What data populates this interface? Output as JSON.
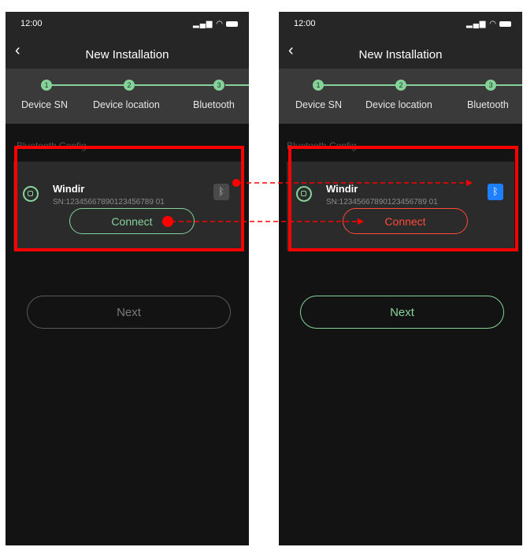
{
  "screens": [
    {
      "id": "left",
      "status_time": "12:00",
      "nav_title": "New Installation",
      "steps": [
        {
          "number": "1",
          "label": "Device SN"
        },
        {
          "number": "2",
          "label": "Device location"
        },
        {
          "number": "3",
          "label": "Bluetooth"
        }
      ],
      "section_label": "Bluetooth Config",
      "device": {
        "name": "Windir",
        "sn": "SN:12345667890123456789 01"
      },
      "connect_label": "Connect",
      "next_label": "Next"
    },
    {
      "id": "right",
      "status_time": "12:00",
      "nav_title": "New Installation",
      "steps": [
        {
          "number": "1",
          "label": "Device SN"
        },
        {
          "number": "2",
          "label": "Device location"
        },
        {
          "number": "3",
          "label": "Bluetooth"
        }
      ],
      "section_label": "Bluetooth Config",
      "device": {
        "name": "Windir",
        "sn": "SN:12345667890123456789 01"
      },
      "connect_label": "Connect",
      "next_label": "Next"
    }
  ],
  "colors": {
    "accent_green": "#86d29b",
    "bluetooth_active": "#1f80ff",
    "annotation_red": "#ff0000",
    "connect_active_red": "#ff4a3a",
    "background": "#131313",
    "bar": "#262626"
  },
  "icons": {
    "back": "chevron-left-icon",
    "device": "device-icon",
    "bluetooth": "bluetooth-icon",
    "signal": "signal-icon",
    "wifi": "wifi-icon",
    "battery": "battery-icon"
  }
}
